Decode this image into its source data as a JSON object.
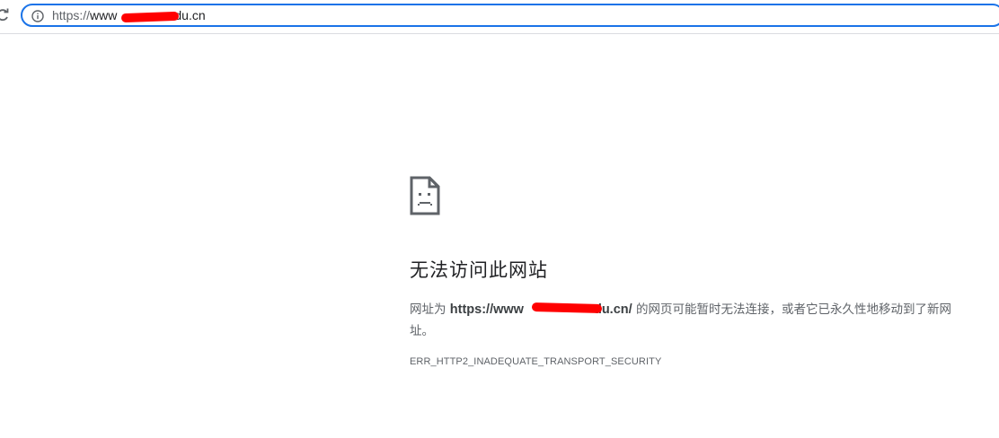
{
  "browser": {
    "reload_icon": "reload-icon",
    "info_icon": "info-icon",
    "address_bar": {
      "scheme": "https://",
      "url_start": "www",
      "url_end": "du.cn"
    }
  },
  "error_page": {
    "icon": "sad-page-icon",
    "title": "无法访问此网站",
    "description_prefix": "网址为 ",
    "url_start": "https://www",
    "url_end": "du.cn/",
    "description_suffix": " 的网页可能暂时无法连接，或者它已永久性地移动到了新网址。",
    "error_code": "ERR_HTTP2_INADEQUATE_TRANSPORT_SECURITY"
  },
  "colors": {
    "accent": "#1a73e8",
    "redaction": "#ff0000",
    "text": "#5f6368",
    "title": "#202124"
  }
}
